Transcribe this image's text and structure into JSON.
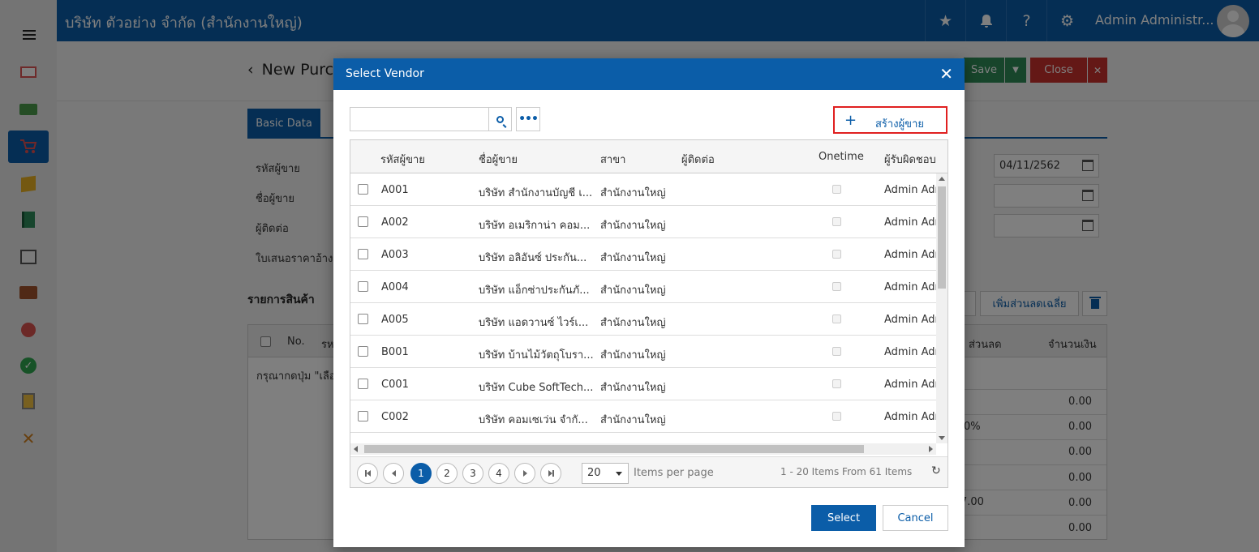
{
  "header": {
    "company": "บริษัท ตัวอย่าง จำกัด (สำนักงานใหญ่)",
    "user_name": "Admin Administr..."
  },
  "page": {
    "title": "New Purc",
    "save_label": "Save",
    "close_label": "Close",
    "tab_basic": "Basic Data",
    "form_labels": [
      "รหัสผู้ขาย",
      "ชื่อผู้ขาย",
      "ผู้ติดต่อ",
      "ใบเสนอราคาอ้างอิ"
    ],
    "date_value": "04/11/2562",
    "section_items": "รายการสินค้า",
    "add_discount_label": "เพิ่มส่วนลดเฉลี่ย",
    "table_headers": {
      "no": "No.",
      "code_partial": "รห",
      "discount": "ส่วนลด",
      "amount": "จำนวนเงิน"
    },
    "empty_hint": "กรุณากดปุ่ม \"เลือ",
    "summary_values": [
      "0.00",
      "0.00",
      "0.00",
      "0.00",
      "0.00",
      "0.00"
    ],
    "summary_left": {
      "percent": "0%",
      "amount": "7.00"
    }
  },
  "modal": {
    "title": "Select Vendor",
    "search_placeholder": "",
    "create_label": "สร้างผู้ขาย",
    "columns": [
      "รหัสผู้ขาย",
      "ชื่อผู้ขาย",
      "สาขา",
      "ผู้ติดต่อ",
      "Onetime",
      "ผู้รับผิดชอบ"
    ],
    "rows": [
      {
        "code": "A001",
        "name": "บริษัท สำนักงานบัญชี เ...",
        "branch": "สำนักงานใหญ่",
        "responsible": "Admin Adm"
      },
      {
        "code": "A002",
        "name": "บริษัท อเมริกาน่า คอม...",
        "branch": "สำนักงานใหญ่",
        "responsible": "Admin Adm"
      },
      {
        "code": "A003",
        "name": "บริษัท อลิอันซ์ ประกัน...",
        "branch": "สำนักงานใหญ่",
        "responsible": "Admin Adm"
      },
      {
        "code": "A004",
        "name": "บริษัท แอ็กซ่าประกันภั...",
        "branch": "สำนักงานใหญ่",
        "responsible": "Admin Adm"
      },
      {
        "code": "A005",
        "name": "บริษัท แอดวานซ์ ไวร์เ...",
        "branch": "สำนักงานใหญ่",
        "responsible": "Admin Adm"
      },
      {
        "code": "B001",
        "name": "บริษัท บ้านไม้วัตถุโบรา...",
        "branch": "สำนักงานใหญ่",
        "responsible": "Admin Adm"
      },
      {
        "code": "C001",
        "name": "บริษัท Cube SoftTech...",
        "branch": "สำนักงานใหญ่",
        "responsible": "Admin Adm"
      },
      {
        "code": "C002",
        "name": "บริษัท คอมเซเว่น จำกั...",
        "branch": "สำนักงานใหญ่",
        "responsible": "Admin Adm"
      }
    ],
    "pages": [
      "1",
      "2",
      "3",
      "4"
    ],
    "page_size": "20",
    "items_per_page": "Items per page",
    "pager_info": "1 - 20 Items From 61 Items",
    "select_label": "Select",
    "cancel_label": "Cancel"
  }
}
